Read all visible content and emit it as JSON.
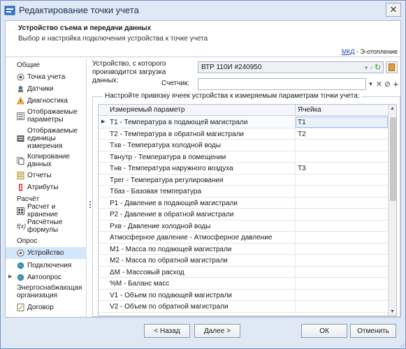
{
  "window": {
    "title": "Редактирование точки учета",
    "close_glyph": "✕"
  },
  "header": {
    "title": "Устройство съема и передачи данных",
    "subtitle": "Выбор и настройка подключения устройства к точке учета",
    "link_text": "МКД",
    "link_suffix": " - Э-отопление"
  },
  "sidebar": {
    "sections": [
      {
        "label": "Общие"
      },
      {
        "label": "Расчёт"
      },
      {
        "label": "Опрос"
      },
      {
        "label": "Энергоснабжающая организация"
      }
    ],
    "items": [
      {
        "label": "Точка учета",
        "icon": "point-icon"
      },
      {
        "label": "Датчики",
        "icon": "sensor-icon"
      },
      {
        "label": "Диагностика",
        "icon": "warning-icon"
      },
      {
        "label": "Отображаемые параметры",
        "icon": "params-icon"
      },
      {
        "label": "Отображаемые единицы измерения",
        "icon": "units-icon"
      },
      {
        "label": "Копирование данных",
        "icon": "copy-icon"
      },
      {
        "label": "Отчеты",
        "icon": "report-icon"
      },
      {
        "label": "Атрибуты",
        "icon": "attribute-icon"
      },
      {
        "label": "Расчет и хранение",
        "icon": "calc-icon"
      },
      {
        "label": "Расчётные формулы",
        "icon": "formula-icon"
      },
      {
        "label": "Устройство",
        "icon": "device-icon"
      },
      {
        "label": "Подключения",
        "icon": "globe-icon"
      },
      {
        "label": "Автоопрос",
        "icon": "autopoll-icon"
      },
      {
        "label": "Договор",
        "icon": "contract-icon"
      }
    ]
  },
  "device": {
    "label": "Устройство, с которого производится загрузка данных:",
    "value": "ВТР 110И #240950"
  },
  "counter": {
    "label": "Счетчик:",
    "value": ""
  },
  "mapping": {
    "group_title": "Настройте привязку ячеек устройства к измеряемым параметрам точки учета:",
    "columns": [
      "Измеряемый параметр",
      "Ячейка"
    ],
    "rows": [
      {
        "param": "T1 - Температура в подающей магистрали",
        "cell": "T1"
      },
      {
        "param": "T2 - Температура в обратной магистрали",
        "cell": "T2"
      },
      {
        "param": "Tхв - Температура холодной воды",
        "cell": ""
      },
      {
        "param": "Tвнутр - Температура в помещении",
        "cell": ""
      },
      {
        "param": "Tнв - Температура наружного воздуха",
        "cell": "T3"
      },
      {
        "param": "Tрег - Температура регулирования",
        "cell": ""
      },
      {
        "param": "Tбаз - Базовая температура",
        "cell": ""
      },
      {
        "param": "P1 - Давление в подающей магистрали",
        "cell": ""
      },
      {
        "param": "P2 - Давление в обратной магистрали",
        "cell": ""
      },
      {
        "param": "Pхв - Давление холодной воды",
        "cell": ""
      },
      {
        "param": "Атмосферное давление - Атмосферное давление",
        "cell": ""
      },
      {
        "param": "M1 - Масса по подающей магистрали",
        "cell": ""
      },
      {
        "param": "M2 - Масса по обратной магистрали",
        "cell": ""
      },
      {
        "param": "ΔM - Массовый расход",
        "cell": ""
      },
      {
        "param": "%M - Баланс масс",
        "cell": ""
      },
      {
        "param": "V1 - Объем по подающей магистрали",
        "cell": ""
      },
      {
        "param": "V2 - Объем по обратной магистрали",
        "cell": ""
      }
    ]
  },
  "footer": {
    "back": "< Назад",
    "next": "Далее >",
    "ok": "ОК",
    "cancel": "Отменить"
  },
  "colors": {
    "accent": "#1d4fb0",
    "selection": "#d4e6fb",
    "frame": "#dfe9f5"
  }
}
